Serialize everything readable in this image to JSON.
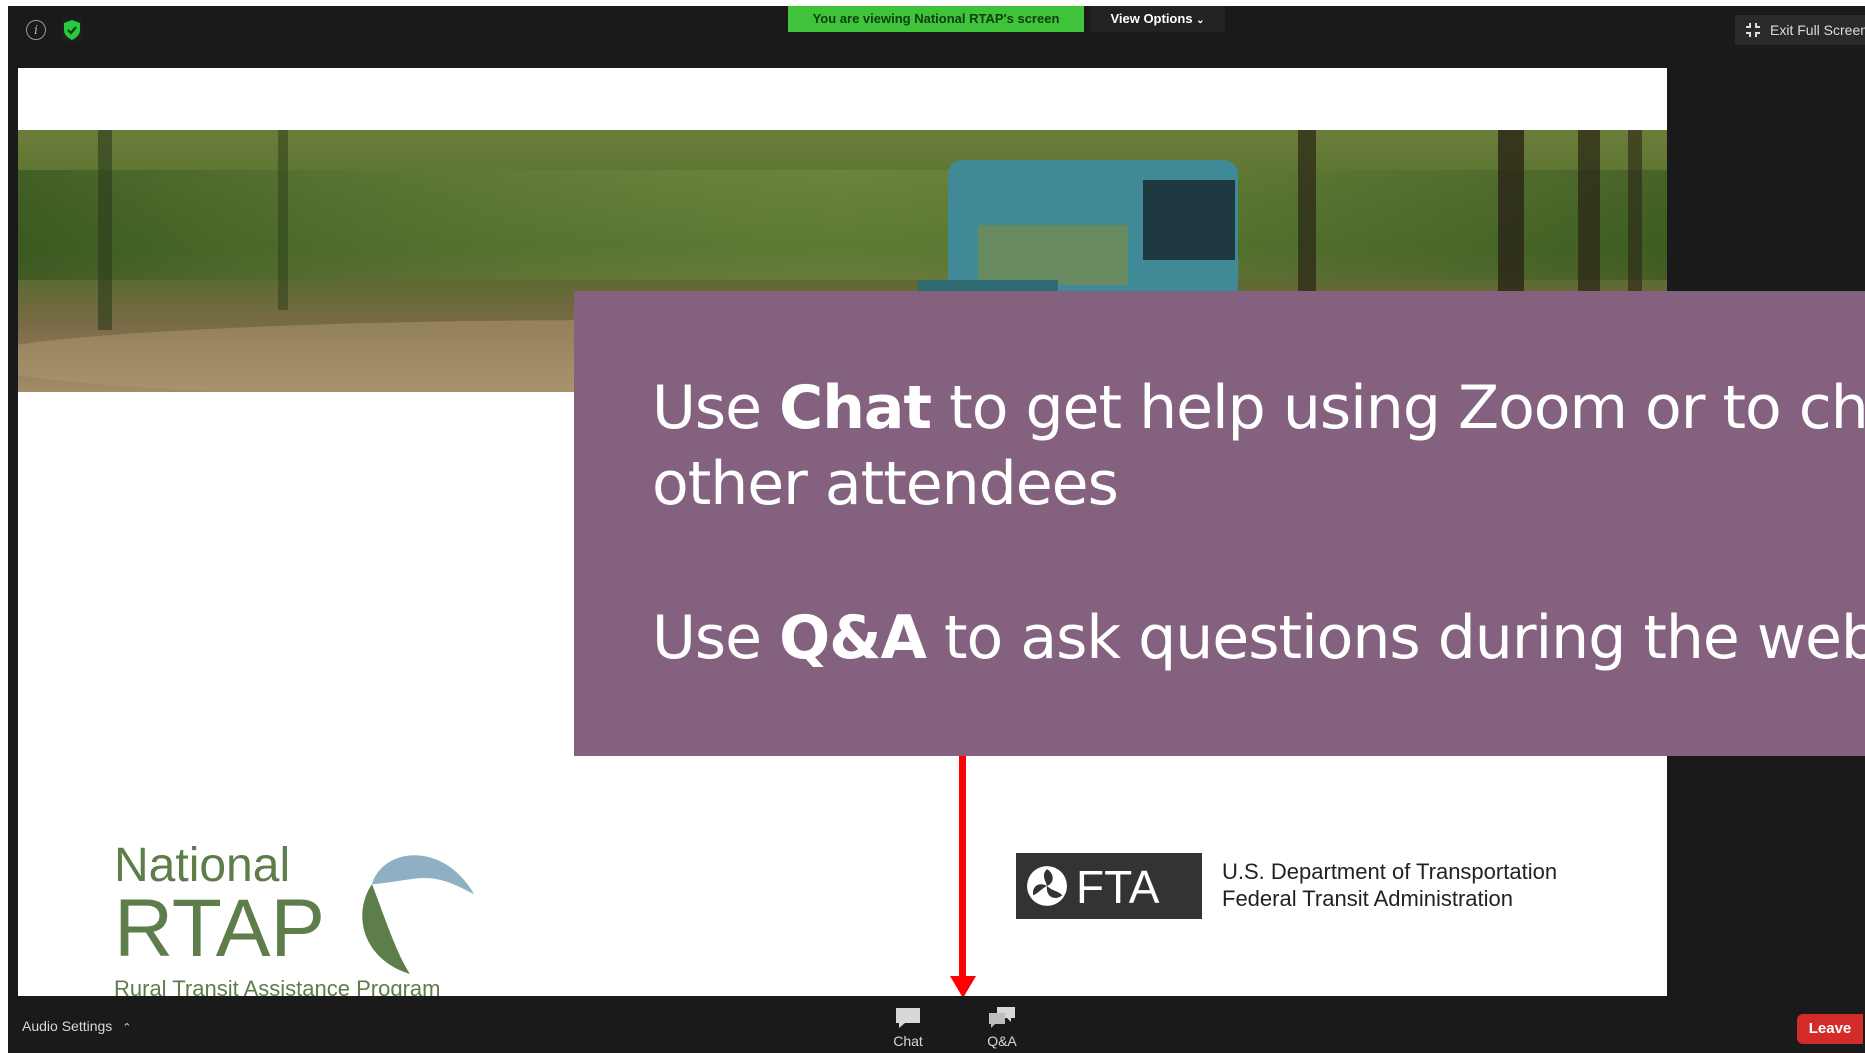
{
  "top_bar": {
    "viewing_banner": "You are viewing National RTAP's screen",
    "view_options_label": "View Options",
    "exit_full_screen_label": "Exit Full Screen",
    "info_icon": "info-icon",
    "security_icon": "shield-check-icon"
  },
  "slide": {
    "rtap_logo": {
      "line1": "National",
      "line2": "RTAP",
      "subtitle": "Rural Transit Assistance Program"
    },
    "fta_logo": {
      "badge": "FTA",
      "line1": "U.S. Department of Transportation",
      "line2": "Federal Transit Administration"
    }
  },
  "popup": {
    "line1_pre": "Use ",
    "line1_bold": "Chat",
    "line1_post": " to get help using Zoom or to chat w",
    "line2": "other attendees",
    "line3_pre": "Use ",
    "line3_bold": "Q&A",
    "line3_post": " to ask questions during the webinar"
  },
  "bottom_bar": {
    "audio_settings_label": "Audio Settings",
    "chat_label": "Chat",
    "qa_label": "Q&A",
    "leave_label": "Leave"
  },
  "colors": {
    "popup_bg": "#83617f",
    "banner_green": "#3ec33a",
    "leave_red": "#d32a2a",
    "arrow_red": "#ff0000",
    "rtap_green": "#5d7d4a"
  }
}
